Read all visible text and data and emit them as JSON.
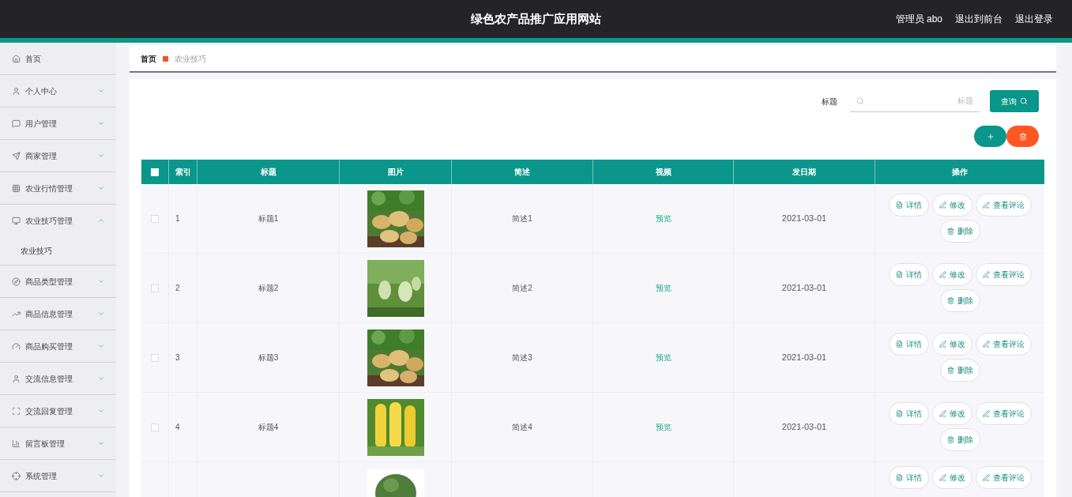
{
  "header": {
    "title": "绿色农产品推广应用网站",
    "links": [
      "管理员 abo",
      "退出到前台",
      "退出登录"
    ]
  },
  "sidebar": {
    "items": [
      {
        "label": "首页",
        "kind": "link"
      },
      {
        "label": "个人中心",
        "kind": "menu",
        "expanded": false
      },
      {
        "label": "用户管理",
        "kind": "menu",
        "expanded": false
      },
      {
        "label": "商家管理",
        "kind": "menu",
        "expanded": false
      },
      {
        "label": "农业行情管理",
        "kind": "menu",
        "expanded": false
      },
      {
        "label": "农业技巧管理",
        "kind": "menu",
        "expanded": true,
        "children": [
          {
            "label": "农业技巧"
          }
        ]
      },
      {
        "label": "商品类型管理",
        "kind": "menu",
        "expanded": false
      },
      {
        "label": "商品信息管理",
        "kind": "menu",
        "expanded": false
      },
      {
        "label": "商品购买管理",
        "kind": "menu",
        "expanded": false
      },
      {
        "label": "交流信息管理",
        "kind": "menu",
        "expanded": false
      },
      {
        "label": "交流回复管理",
        "kind": "menu",
        "expanded": false
      },
      {
        "label": "留言板管理",
        "kind": "menu",
        "expanded": false
      },
      {
        "label": "系统管理",
        "kind": "menu",
        "expanded": false
      }
    ]
  },
  "breadcrumb": [
    "首页",
    "农业技巧"
  ],
  "search": {
    "label": "标题",
    "placeholder": "标题",
    "button": "查询"
  },
  "table": {
    "header_checked": false,
    "columns": [
      "索引",
      "标题",
      "图片",
      "简述",
      "视频",
      "发日期",
      "操作"
    ],
    "rows": [
      {
        "checked": false,
        "index": "1",
        "title": "标题1",
        "summary": "简述1",
        "video": "预览",
        "date": "2021-03-01",
        "actions": [
          "详情",
          "修改",
          "查看评论",
          "删除"
        ]
      },
      {
        "checked": false,
        "index": "2",
        "title": "标题2",
        "summary": "简述2",
        "video": "预览",
        "date": "2021-03-01",
        "actions": [
          "详情",
          "修改",
          "查看评论",
          "删除"
        ]
      },
      {
        "checked": false,
        "index": "3",
        "title": "标题3",
        "summary": "简述3",
        "video": "预览",
        "date": "2021-03-01",
        "actions": [
          "详情",
          "修改",
          "查看评论",
          "删除"
        ]
      },
      {
        "checked": false,
        "index": "4",
        "title": "标题4",
        "summary": "简述4",
        "video": "预览",
        "date": "2021-03-01",
        "actions": [
          "详情",
          "修改",
          "查看评论",
          "删除"
        ]
      },
      {
        "actions": [
          "详情",
          "修改",
          "查看评论"
        ]
      }
    ]
  }
}
